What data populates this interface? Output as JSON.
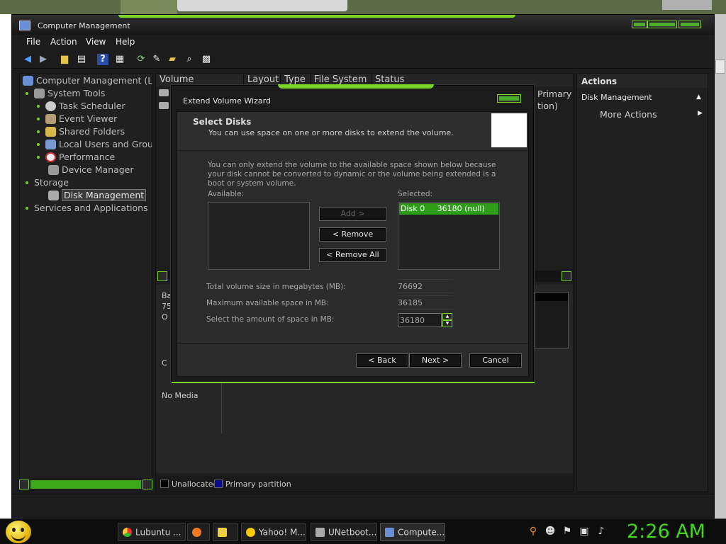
{
  "window": {
    "title": "Computer Management"
  },
  "menu": [
    "File",
    "Action",
    "View",
    "Help"
  ],
  "toolbar_icons": [
    "back-arrow-icon",
    "forward-arrow-icon",
    "folder-icon",
    "properties-icon",
    "help-icon",
    "list-icon",
    "refresh-icon",
    "export-icon",
    "open-folder-icon",
    "search-icon",
    "grid-icon"
  ],
  "tree": {
    "root": "Computer Management (Loc",
    "system_tools": "System Tools",
    "task_scheduler": "Task Scheduler",
    "event_viewer": "Event Viewer",
    "shared_folders": "Shared Folders",
    "local_users": "Local Users and Grou",
    "performance": "Performance",
    "device_manager": "Device Manager",
    "storage": "Storage",
    "disk_management": "Disk Management",
    "services": "Services and Applications"
  },
  "volume_columns": [
    "Volume",
    "Layout",
    "Type",
    "File System",
    "Status"
  ],
  "volume_status_partial": [
    "Primary",
    "tion)"
  ],
  "disk_panel": {
    "disk0_lines": [
      "Ba",
      "75",
      "O"
    ],
    "cd_label": "C",
    "no_media": "No Media"
  },
  "legend": {
    "unallocated": "Unallocated",
    "primary_partition": "Primary partition",
    "unallocated_color": "#000000",
    "primary_color": "#0a0a8c"
  },
  "actions": {
    "header": "Actions",
    "section": "Disk Management",
    "more": "More Actions"
  },
  "wizard": {
    "title": "Extend Volume Wizard",
    "heading": "Select Disks",
    "subheading": "You can use space on one or more disks to extend the volume.",
    "description": "You can only extend the volume to the available space shown below because your disk cannot be converted to dynamic or the volume being extended is a boot or system volume.",
    "available_label": "Available:",
    "selected_label": "Selected:",
    "selected_items": [
      "Disk 0     36180 (null)"
    ],
    "add_button": "Add >",
    "remove_button": "< Remove",
    "remove_all_button": "< Remove All",
    "total_label": "Total volume size in megabytes (MB):",
    "total_value": "76692",
    "max_label": "Maximum available space in MB:",
    "max_value": "36185",
    "amount_label": "Select the amount of space in MB:",
    "amount_value": "36180",
    "back_button": "< Back",
    "next_button": "Next >",
    "cancel_button": "Cancel"
  },
  "taskbar": {
    "tasks": [
      "Lubuntu ...",
      "",
      "",
      "Yahoo! M...",
      "UNetboot...",
      "Compute..."
    ],
    "clock": "2:26 AM"
  },
  "colors": {
    "accent": "#7cd42a",
    "clock": "#43d61e",
    "selected": "#2e9e1a"
  }
}
